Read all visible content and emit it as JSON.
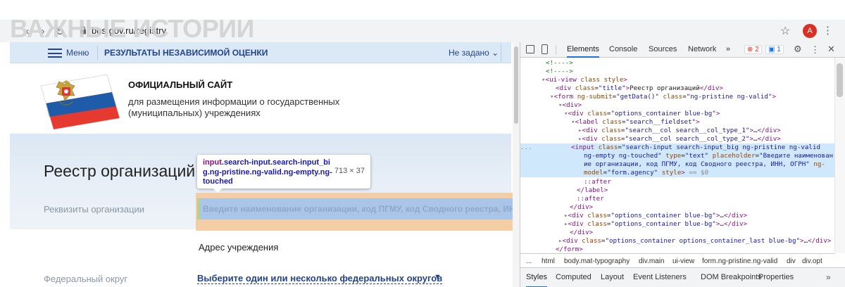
{
  "browser": {
    "url": "bus.gov.ru/registry",
    "avatar_letter": "A",
    "back_icon": "‹",
    "forward_icon": "›",
    "reload_icon": "↻"
  },
  "watermark": "ВАЖНЫЕ ИСТОРИИ",
  "site": {
    "menu_label": "Меню",
    "nav_title": "РЕЗУЛЬТАТЫ НЕЗАВИСИМОЙ ОЦЕНКИ",
    "nav_select": "Не задано",
    "header_title": "ОФИЦИАЛЬНЫЙ САЙТ",
    "header_sub1": "для размещения информации о государственных",
    "header_sub2": "(муниципальных) учреждениях",
    "page_title": "Реестр организаций",
    "req_label": "Реквизиты организации",
    "search_placeholder": "Введите наименование организации, код ПГМУ, код Сводного реестра, ИНН, ОГРН",
    "address_title": "Адрес учреждения",
    "fed_label": "Федеральный округ",
    "fed_select": "Выберите один или несколько федеральных округов"
  },
  "tooltip": {
    "tag": "input",
    "selector": ".search-input.search-input_big.ng-pristine.ng-valid.ng-empty.ng-touched",
    "size": "713 × 37"
  },
  "devtools": {
    "tabs": [
      "Elements",
      "Console",
      "Sources",
      "Network"
    ],
    "more_tabs": "»",
    "errors": "2",
    "messages": "1",
    "breadcrumbs": [
      "...",
      "html",
      "body.mat-typography",
      "div.main",
      "ui-view",
      "form.ng-pristine.ng-valid",
      "div",
      "div.opt"
    ],
    "bottom_tabs": [
      "Styles",
      "Computed",
      "Layout",
      "Event Listeners",
      "DOM Breakpoints",
      "Properties"
    ],
    "bottom_more": "»"
  }
}
